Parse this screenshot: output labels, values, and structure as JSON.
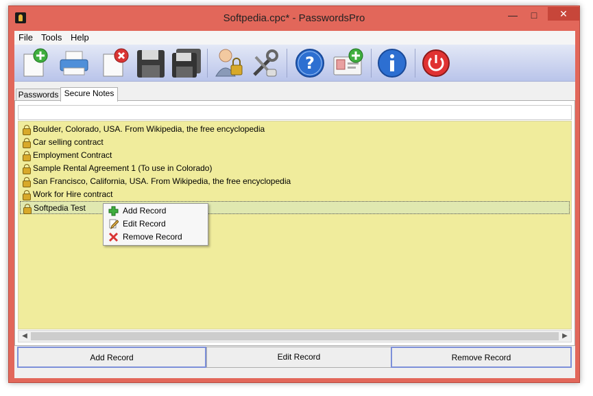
{
  "window": {
    "title": "Softpedia.cpc* - PasswordsPro"
  },
  "menu": [
    "File",
    "Tools",
    "Help"
  ],
  "toolbar": [
    {
      "name": "new-file-icon"
    },
    {
      "name": "printer-icon"
    },
    {
      "name": "close-file-icon"
    },
    {
      "name": "save-icon"
    },
    {
      "name": "save-all-icon"
    },
    {
      "name": "user-lock-icon"
    },
    {
      "name": "tools-icon"
    },
    {
      "name": "help-icon"
    },
    {
      "name": "add-card-icon"
    },
    {
      "name": "info-icon"
    },
    {
      "name": "power-icon"
    }
  ],
  "tabs": [
    "Passwords",
    "Secure Notes"
  ],
  "filter": {
    "value": ""
  },
  "notes": [
    "Boulder, Colorado, USA. From Wikipedia, the free encyclopedia",
    "Car selling contract",
    "Employment Contract",
    "Sample Rental Agreement 1 (To use in Colorado)",
    "San Francisco, California, USA. From Wikipedia, the free encyclopedia",
    "Work for Hire contract",
    "Softpedia Test"
  ],
  "context_menu": [
    "Add Record",
    "Edit Record",
    "Remove Record"
  ],
  "buttons": {
    "add": "Add Record",
    "edit": "Edit Record",
    "remove": "Remove Record"
  },
  "colors": {
    "frame": "#e2675a",
    "list_bg": "#f0ec9c",
    "accent": "#7c8fd9"
  }
}
